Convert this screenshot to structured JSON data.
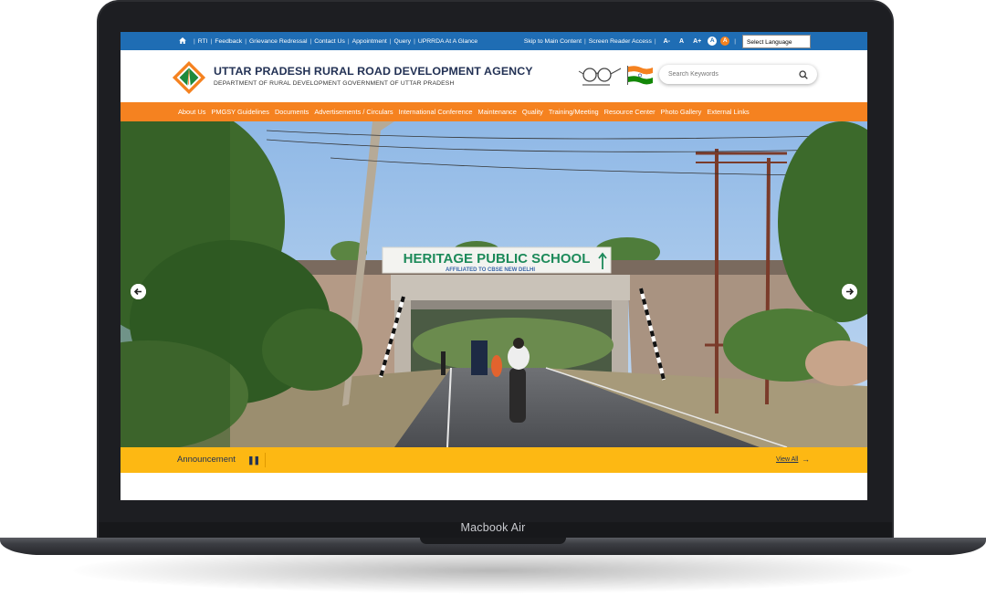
{
  "device": {
    "brand_label": "Macbook Air"
  },
  "topbar": {
    "links": [
      "RTI",
      "Feedback",
      "Grievance Redressal",
      "Contact Us",
      "Appointment",
      "Query",
      "UPRRDA At A Glance"
    ],
    "skip_label": "Skip to Main Content",
    "screen_reader_label": "Screen Reader Access",
    "font_decrease": "A-",
    "font_normal": "A",
    "font_increase": "A+",
    "contrast_a": "A",
    "contrast_b": "A",
    "language_select": "Select Language"
  },
  "header": {
    "title": "UTTAR PRADESH RURAL ROAD DEVELOPMENT AGENCY",
    "subtitle": "DEPARTMENT OF RURAL DEVELOPMENT GOVERNMENT OF UTTAR PRADESH",
    "search_placeholder": "Search Keywords"
  },
  "nav": {
    "items": [
      "About Us",
      "PMGSY Guidelines",
      "Documents",
      "Advertisements / Circulars",
      "International Conference",
      "Maintenance",
      "Quality",
      "Training/Meeting",
      "Resource Center",
      "Photo Gallery",
      "External Links"
    ]
  },
  "slider": {
    "sign_main": "HERITAGE PUBLIC SCHOOL",
    "sign_sub": "AFFILIATED TO CBSE NEW DELHI"
  },
  "announcement": {
    "label": "Announcement",
    "view_all": "View All"
  },
  "colors": {
    "topbar": "#1f6db4",
    "nav": "#f58220",
    "announcement": "#fdb813",
    "title": "#233255"
  }
}
